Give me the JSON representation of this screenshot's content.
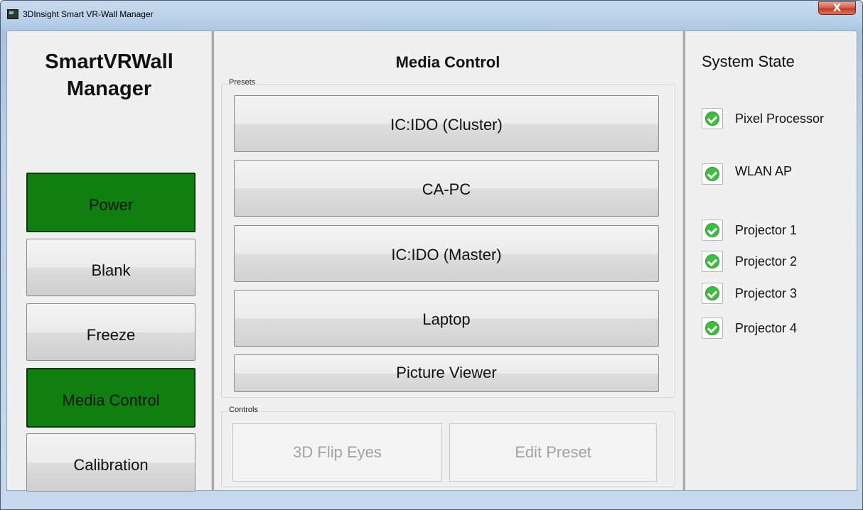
{
  "window": {
    "title": "3DInsight Smart VR-Wall Manager",
    "close_symbol": "X"
  },
  "brand": {
    "line1": "SmartVRWall",
    "line2": "Manager"
  },
  "nav": [
    {
      "label": "Power",
      "active": true
    },
    {
      "label": "Blank",
      "active": false
    },
    {
      "label": "Freeze",
      "active": false
    },
    {
      "label": "Media Control",
      "active": true
    },
    {
      "label": "Calibration",
      "active": false
    }
  ],
  "media_control": {
    "title": "Media Control",
    "presets_label": "Presets",
    "presets": [
      "IC:IDO (Cluster)",
      "CA-PC",
      "IC:IDO (Master)",
      "Laptop",
      "Picture Viewer"
    ],
    "controls_label": "Controls",
    "controls": [
      {
        "label": "3D Flip Eyes",
        "enabled": false
      },
      {
        "label": "Edit Preset",
        "enabled": false
      }
    ]
  },
  "system_state": {
    "title": "System State",
    "items": [
      {
        "label": "Pixel Processor",
        "ok": true
      },
      {
        "label": "WLAN AP",
        "ok": true
      },
      {
        "label": "Projector 1",
        "ok": true
      },
      {
        "label": "Projector 2",
        "ok": true
      },
      {
        "label": "Projector 3",
        "ok": true
      },
      {
        "label": "Projector 4",
        "ok": true
      }
    ]
  },
  "colors": {
    "active_green": "#0f7f0f",
    "check_green": "#3cbf3c",
    "disabled_text": "#a3a3a3"
  }
}
